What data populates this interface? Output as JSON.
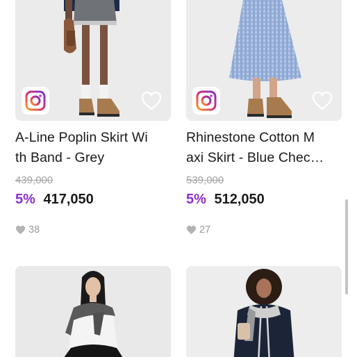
{
  "products": [
    {
      "name": "A-Line Poplin Skirt With Band - Grey",
      "name_display": "A-Line Poplin Skirt Wi\nth Band - Grey",
      "original_price": "439,000",
      "discount": "5%",
      "price": "417,050",
      "likes": "38",
      "badge_icon": "instagram-icon",
      "wishlist_icon": "heart-outline-icon"
    },
    {
      "name": "Rhinestone Cotton Maxi Skirt - Blue Check",
      "name_display": "Rhinestone Cotton M\naxi Skirt - Blue Chec…",
      "original_price": "539,000",
      "discount": "5%",
      "price": "512,050",
      "likes": "27",
      "badge_icon": "instagram-icon",
      "wishlist_icon": "heart-outline-icon"
    },
    {
      "image": "product-photo"
    },
    {
      "image": "product-photo"
    }
  ],
  "colors": {
    "discount": "#8b2fd3",
    "price": "#1a1a1a",
    "strike": "#a3a3a3",
    "likes": "#9a9a9a"
  }
}
